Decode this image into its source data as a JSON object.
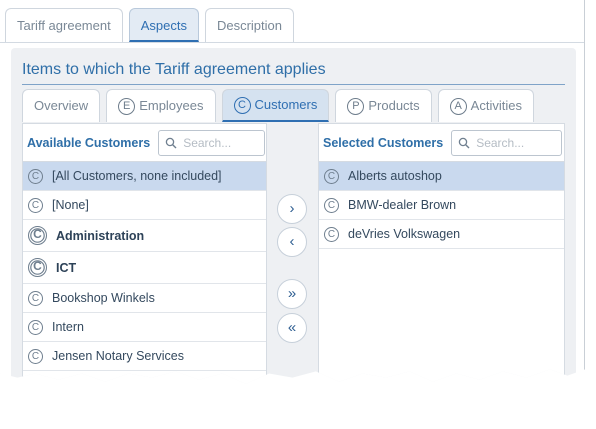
{
  "top_tabs": [
    "Tariff agreement",
    "Aspects",
    "Description"
  ],
  "active_top_tab": "Aspects",
  "section_title": "Items to which the Tariff agreement applies",
  "inner_tabs": [
    {
      "label": "Overview",
      "badge": ""
    },
    {
      "label": "Employees",
      "badge": "E"
    },
    {
      "label": "Customers",
      "badge": "C"
    },
    {
      "label": "Products",
      "badge": "P"
    },
    {
      "label": "Activities",
      "badge": "A"
    }
  ],
  "active_inner_tab": "Customers",
  "available": {
    "title": "Available Customers",
    "search_placeholder": "Search...",
    "items": [
      {
        "label": "[All Customers, none included]",
        "selected": true,
        "group": false
      },
      {
        "label": "[None]",
        "selected": false,
        "group": false
      },
      {
        "label": "Administration",
        "selected": false,
        "group": true
      },
      {
        "label": "ICT",
        "selected": false,
        "group": true
      },
      {
        "label": "Bookshop Winkels",
        "selected": false,
        "group": false
      },
      {
        "label": "Intern",
        "selected": false,
        "group": false
      },
      {
        "label": "Jensen Notary Services",
        "selected": false,
        "group": false
      }
    ]
  },
  "selected": {
    "title": "Selected Customers",
    "search_placeholder": "Search...",
    "items": [
      {
        "label": "Alberts autoshop",
        "selected": true
      },
      {
        "label": "BMW-dealer Brown",
        "selected": false
      },
      {
        "label": "deVries Volkswagen",
        "selected": false
      }
    ]
  },
  "transfer_buttons": {
    "add": "›",
    "remove": "‹",
    "add_all": "»",
    "remove_all": "«"
  },
  "icon_letter": "C",
  "colors": {
    "accent": "#2f6fb2",
    "selected_row": "#c9d9ee",
    "panel_bg": "#eef0f3"
  }
}
